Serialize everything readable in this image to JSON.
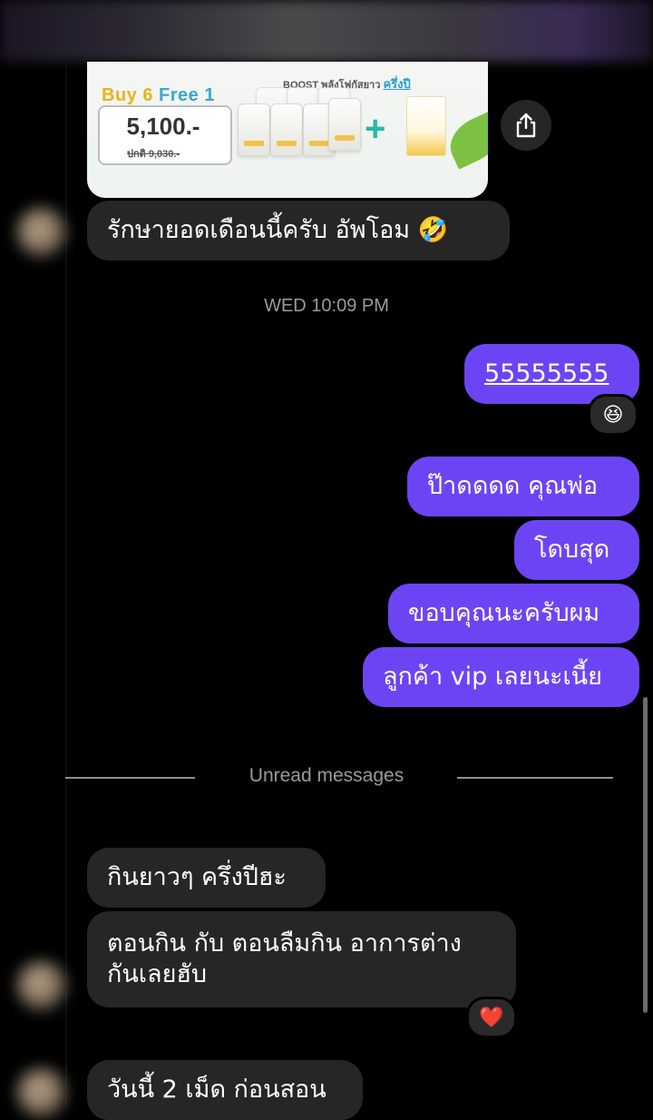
{
  "shared_post": {
    "promo_buy": "Buy 6",
    "promo_free": "Free 1",
    "price": "5,100.-",
    "normal_price": "ปกติ 9,030.-",
    "boost_text": "BOOST พลังโฟกัสยาว",
    "boost_highlight": "ครึ่งปี"
  },
  "messages": {
    "m1": "รักษายอดเดือนนี้ครับ อัพโอม 🤣",
    "timestamp": "WED 10:09 PM",
    "m2": "55555555",
    "m2_reaction": "😆",
    "m3": "ป๊าดดดด คุณพ่อ",
    "m4": "โดบสุด",
    "m5": "ขอบคุณนะครับผม",
    "m6": "ลูกค้า vip เลยนะเนี้ย",
    "unread_label": "Unread messages",
    "m7": "กินยาวๆ ครึ่งปีฮะ",
    "m8_line1": "ตอนกิน กับ ตอนลืมกิน อาการต่าง",
    "m8_line2": "กันเลยฮับ",
    "m8_reaction": "❤️",
    "m9": "วันนี้ 2 เม็ด ก่อนสอน"
  },
  "colors": {
    "outgoing_bubble": "#6d44f4",
    "incoming_bubble": "#262626",
    "background": "#000000"
  },
  "icons": {
    "share": "share-icon"
  }
}
